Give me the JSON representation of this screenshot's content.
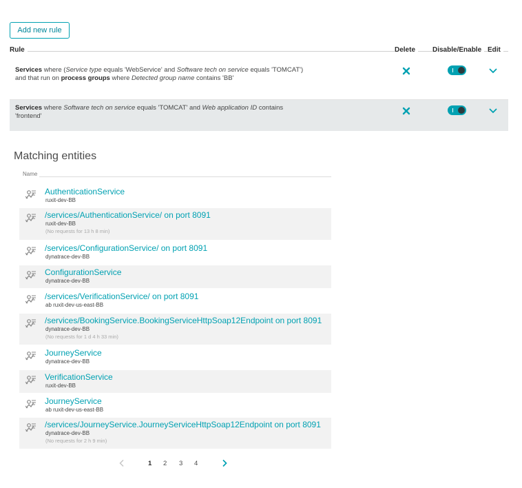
{
  "toolbar": {
    "add_rule_label": "Add new rule"
  },
  "rules_header": {
    "rule": "Rule",
    "delete": "Delete",
    "disable_enable": "Disable/Enable",
    "edit": "Edit"
  },
  "rules": [
    {
      "segments": [
        {
          "t": "Services",
          "s": "b"
        },
        {
          "t": " where (",
          "s": ""
        },
        {
          "t": "Service type",
          "s": "i"
        },
        {
          "t": " equals 'WebService' and ",
          "s": ""
        },
        {
          "t": "Software tech on service",
          "s": "i"
        },
        {
          "t": " equals 'TOMCAT')",
          "s": ""
        },
        {
          "t": "\n",
          "s": ""
        },
        {
          "t": "and that run on ",
          "s": ""
        },
        {
          "t": "process groups",
          "s": "b"
        },
        {
          "t": " where ",
          "s": ""
        },
        {
          "t": "Detected group name",
          "s": "i"
        },
        {
          "t": " contains 'BB'",
          "s": ""
        }
      ],
      "enabled": true
    },
    {
      "segments": [
        {
          "t": "Services",
          "s": "b"
        },
        {
          "t": " where ",
          "s": ""
        },
        {
          "t": "Software tech on service",
          "s": "i"
        },
        {
          "t": " equals 'TOMCAT' and ",
          "s": ""
        },
        {
          "t": "Web application ID",
          "s": "i"
        },
        {
          "t": " contains 'frontend'",
          "s": ""
        }
      ],
      "enabled": true
    }
  ],
  "matching": {
    "title": "Matching entities",
    "name_header": "Name",
    "entities": [
      {
        "name": "AuthenticationService",
        "sub": "ruxit-dev-BB",
        "note": ""
      },
      {
        "name": "/services/AuthenticationService/ on port 8091",
        "sub": "ruxit-dev-BB",
        "note": "(No requests for 13 h 8 min)"
      },
      {
        "name": "/services/ConfigurationService/ on port 8091",
        "sub": "dynatrace-dev-BB",
        "note": ""
      },
      {
        "name": "ConfigurationService",
        "sub": "dynatrace-dev-BB",
        "note": ""
      },
      {
        "name": "/services/VerificationService/ on port 8091",
        "sub": "ab ruxit-dev-us-east-BB",
        "note": ""
      },
      {
        "name": "/services/BookingService.BookingServiceHttpSoap12Endpoint on port 8091",
        "sub": "dynatrace-dev-BB",
        "note": "(No requests for 1 d 4 h 33 min)"
      },
      {
        "name": "JourneyService",
        "sub": "dynatrace-dev-BB",
        "note": ""
      },
      {
        "name": "VerificationService",
        "sub": "ruxit-dev-BB",
        "note": ""
      },
      {
        "name": "JourneyService",
        "sub": "ab ruxit-dev-us-east-BB",
        "note": ""
      },
      {
        "name": "/services/JourneyService.JourneyServiceHttpSoap12Endpoint on port 8091",
        "sub": "dynatrace-dev-BB",
        "note": "(No requests for 2 h 9 min)"
      }
    ]
  },
  "pagination": {
    "pages": [
      "1",
      "2",
      "3",
      "4"
    ],
    "current": "1",
    "prev_icon": "chevron-left-icon",
    "next_icon": "chevron-right-icon"
  },
  "colors": {
    "accent": "#00a1b2",
    "selected_row": "#e6e9ea",
    "striped_row": "#f2f2f2"
  },
  "icons": {
    "delete": "close-icon",
    "toggle": "toggle-switch",
    "edit": "chevron-down-icon",
    "entity": "service-icon"
  }
}
